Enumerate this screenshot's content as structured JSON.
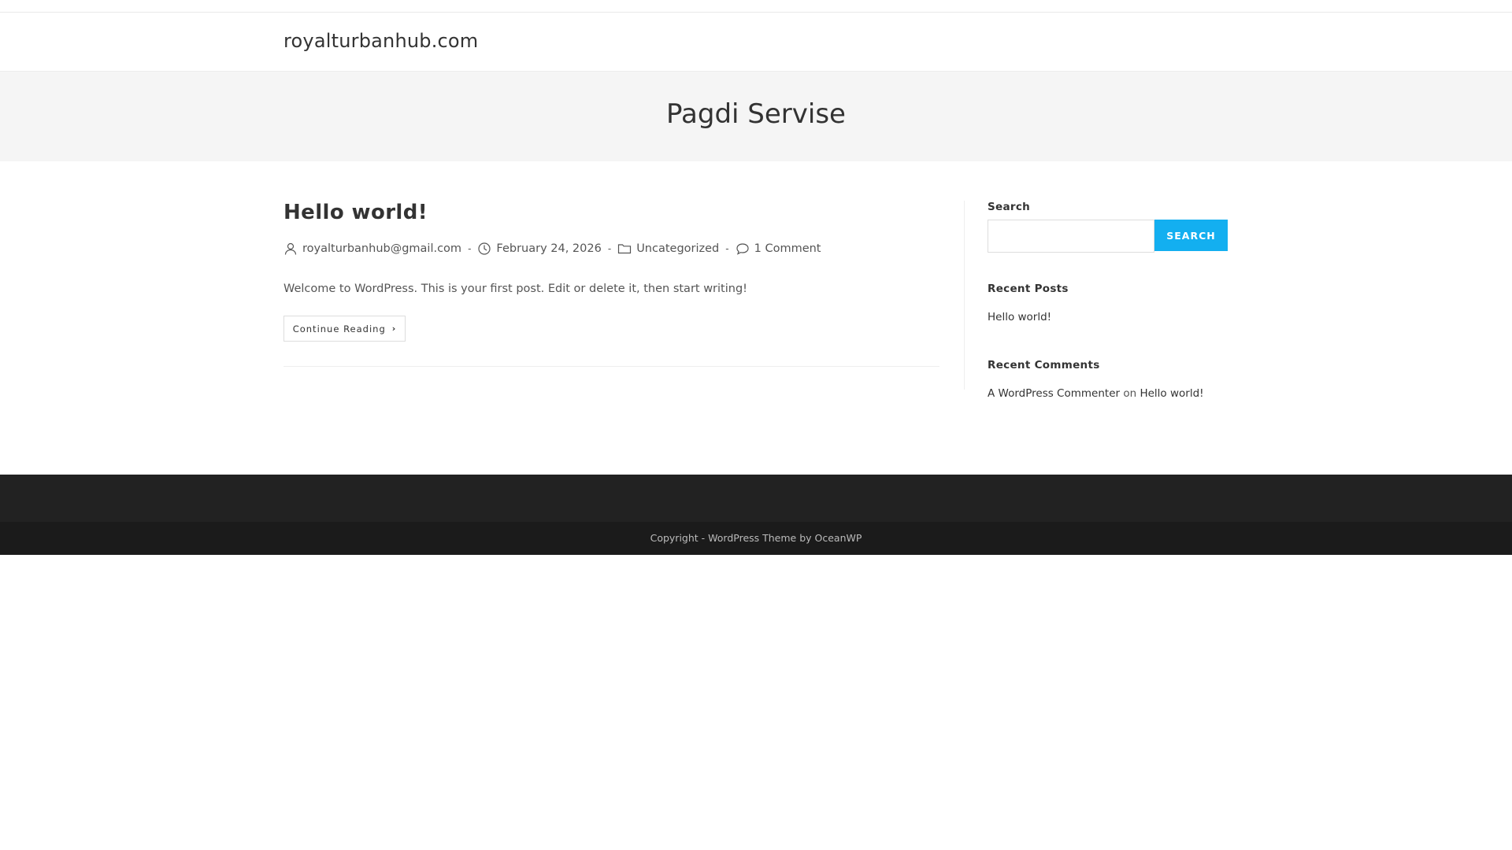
{
  "header": {
    "site_title": "royalturbanhub.com"
  },
  "page_header": {
    "title": "Pagdi Servise"
  },
  "post": {
    "title": "Hello world!",
    "meta": {
      "author": "royalturbanhub@gmail.com",
      "date": "February 24, 2026",
      "category": "Uncategorized",
      "comments": "1 Comment",
      "separator": "-"
    },
    "excerpt": "Welcome to WordPress. This is your first post. Edit or delete it, then start writing!",
    "continue_label": "Continue Reading",
    "continue_icon": "chevron-right-icon"
  },
  "sidebar": {
    "search": {
      "title": "Search",
      "placeholder": "",
      "button_label": "SEARCH",
      "button_color": "#13aff0"
    },
    "recent_posts": {
      "title": "Recent Posts",
      "items": [
        "Hello world!"
      ]
    },
    "recent_comments": {
      "title": "Recent Comments",
      "author": "A WordPress Commenter",
      "on": "on",
      "post": "Hello world!"
    }
  },
  "footer": {
    "copyright": "Copyright - WordPress Theme by OceanWP"
  },
  "colors": {
    "accent": "#13aff0",
    "footer_bg": "#222222",
    "page_header_bg": "#f5f5f5"
  }
}
